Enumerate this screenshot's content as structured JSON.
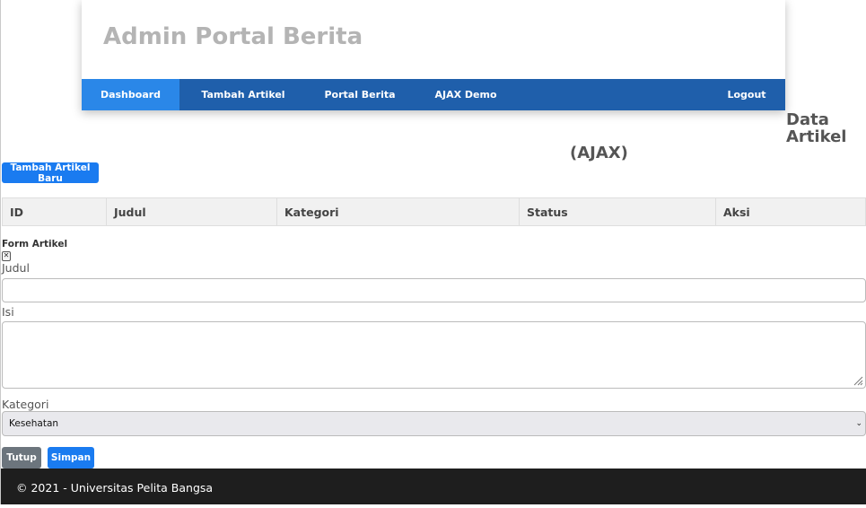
{
  "header": {
    "title": "Admin Portal Berita",
    "nav": [
      {
        "label": "Dashboard",
        "active": true
      },
      {
        "label": "Tambah Artikel",
        "active": false
      },
      {
        "label": "Portal Berita",
        "active": false
      },
      {
        "label": "AJAX Demo",
        "active": false
      },
      {
        "label": "Logout",
        "active": false
      }
    ]
  },
  "page": {
    "title_line1": "Data",
    "title_line2": "Artikel",
    "title_suffix": "(AJAX)",
    "add_button": "Tambah Artikel Baru"
  },
  "table": {
    "columns": [
      "ID",
      "Judul",
      "Kategori",
      "Status",
      "Aksi"
    ]
  },
  "form": {
    "title": "Form Artikel",
    "close_icon": "close-icon",
    "judul_label": "Judul",
    "judul_value": "",
    "isi_label": "Isi",
    "isi_value": "",
    "kategori_label": "Kategori",
    "kategori_selected": "Kesehatan",
    "tutup_button": "Tutup",
    "simpan_button": "Simpan"
  },
  "footer": {
    "text": "© 2021 - Universitas Pelita Bangsa"
  },
  "colors": {
    "nav_bg": "#1f5fab",
    "nav_active": "#2a87e8",
    "primary": "#1a7bf0",
    "secondary": "#6c757d",
    "footer_bg": "#1e1e1e"
  }
}
